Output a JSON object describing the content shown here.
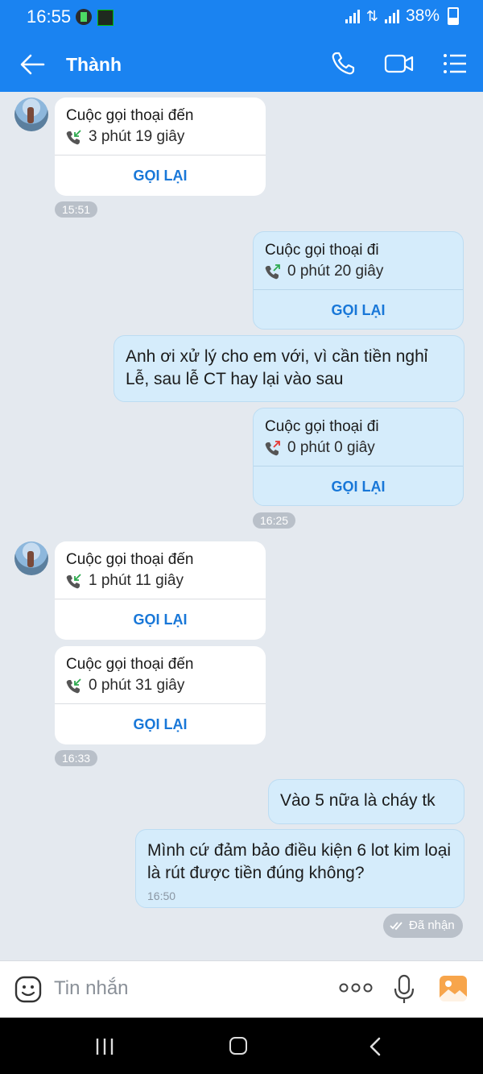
{
  "status_bar": {
    "time": "16:55",
    "battery": "38%"
  },
  "header": {
    "title": "Thành"
  },
  "colors": {
    "primary": "#1a83f1",
    "outgoing_bubble": "#d5ecfb",
    "incoming_bubble": "#ffffff",
    "missed_call": "#e53935",
    "call_green": "#2eaa4f"
  },
  "messages": {
    "call1": {
      "title": "Cuộc gọi thoại đến",
      "duration": "3 phút 19 giây",
      "action": "GỌI LẠI"
    },
    "ts1": "15:51",
    "call2": {
      "title": "Cuộc gọi thoại đi",
      "duration": "0 phút 20 giây",
      "action": "GỌI LẠI"
    },
    "text1": "Anh ơi xử lý cho em với, vì cần tiền nghỉ Lễ, sau lễ CT hay lại vào sau",
    "call3": {
      "title": "Cuộc gọi thoại đi",
      "duration": "0 phút 0 giây",
      "action": "GỌI LẠI"
    },
    "ts2": "16:25",
    "call4": {
      "title": "Cuộc gọi thoại đến",
      "duration": "1 phút 11 giây",
      "action": "GỌI LẠI"
    },
    "call5": {
      "title": "Cuộc gọi thoại đến",
      "duration": "0 phút 31 giây",
      "action": "GỌI LẠI"
    },
    "ts3": "16:33",
    "text2": "Vào 5 nữa là cháy tk",
    "text3": "Mình cứ đảm bảo điều kiện 6 lot kim loại là rút được tiền đúng không?",
    "text3_time": "16:50",
    "status": "Đã nhận"
  },
  "composer": {
    "placeholder": "Tin nhắn"
  }
}
